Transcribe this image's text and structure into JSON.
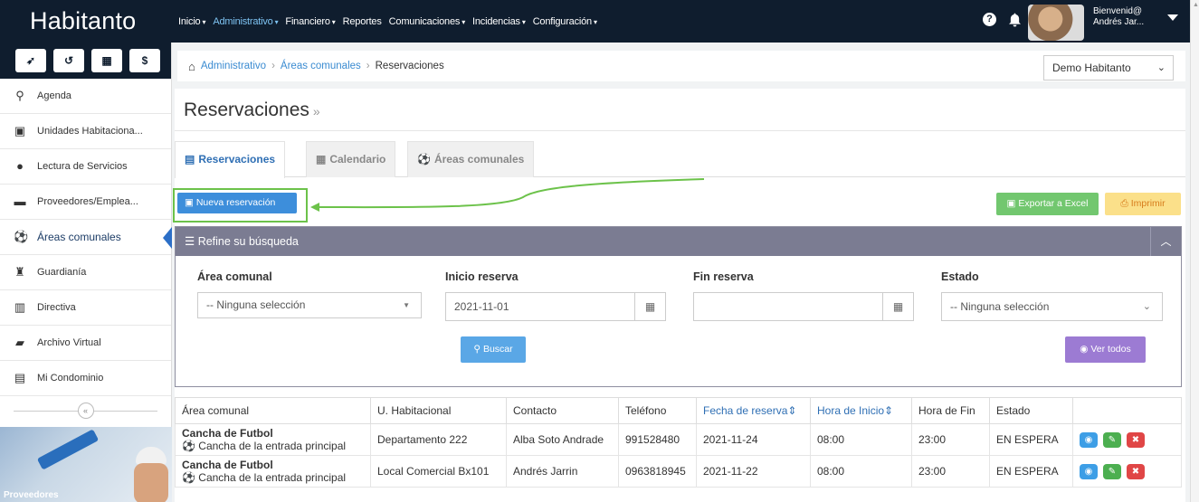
{
  "app": {
    "brand": "Habitanto",
    "menu": [
      {
        "label": "Inicio",
        "active": false
      },
      {
        "label": "Administrativo",
        "active": true
      },
      {
        "label": "Financiero",
        "active": false
      },
      {
        "label": "Reportes",
        "active": false,
        "no_caret": true
      },
      {
        "label": "Comunicaciones",
        "active": false
      },
      {
        "label": "Incidencias",
        "active": false
      },
      {
        "label": "Configuración",
        "active": false
      }
    ],
    "user": {
      "greeting": "Bienvenid@",
      "name": "Andrés Jar..."
    }
  },
  "sidebar": {
    "quick_icons": [
      "paper-plane-icon",
      "history-icon",
      "calculator-icon",
      "dollar-icon"
    ],
    "items": [
      {
        "label": "Agenda",
        "icon": "person-icon",
        "glyph": "🕴"
      },
      {
        "label": "Unidades Habitaciona...",
        "icon": "building-h-icon",
        "glyph": "🅷"
      },
      {
        "label": "Lectura de Servicios",
        "icon": "drop-icon",
        "glyph": "💧"
      },
      {
        "label": "Proveedores/Emplea...",
        "icon": "truck-icon",
        "glyph": "🚚"
      },
      {
        "label": "Áreas comunales",
        "icon": "soccer-ball-icon",
        "glyph": "⚽",
        "active": true
      },
      {
        "label": "Guardianía",
        "icon": "guard-icon",
        "glyph": "🛡"
      },
      {
        "label": "Directiva",
        "icon": "columns-icon",
        "glyph": "▥"
      },
      {
        "label": "Archivo Virtual",
        "icon": "folder-icon",
        "glyph": "📁"
      },
      {
        "label": "Mi Condominio",
        "icon": "apartment-icon",
        "glyph": "🏢"
      }
    ],
    "promo_text": "Proveedores"
  },
  "breadcrumb": {
    "items": [
      "Administrativo",
      "Áreas comunales",
      "Reservaciones"
    ]
  },
  "org_select": {
    "value": "Demo Habitanto"
  },
  "page": {
    "title": "Reservaciones",
    "title_suffix": "»"
  },
  "tabs": [
    {
      "label": "Reservaciones",
      "active": true
    },
    {
      "label": "Calendario",
      "active": false
    },
    {
      "label": "Áreas comunales",
      "active": false
    }
  ],
  "toolbar": {
    "new_label": "Nueva reservación",
    "excel_label": "Exportar a Excel",
    "print_label": "Imprimir"
  },
  "filter": {
    "title": "Refine su búsqueda",
    "area_label": "Área comunal",
    "area_value": "-- Ninguna selección",
    "start_label": "Inicio reserva",
    "start_value": "2021-11-01",
    "end_label": "Fin reserva",
    "end_value": "",
    "status_label": "Estado",
    "status_value": "-- Ninguna selección",
    "search_label": "Buscar",
    "all_label": "Ver todos"
  },
  "table": {
    "columns": [
      "Área comunal",
      "U. Habitacional",
      "Contacto",
      "Teléfono",
      "Fecha de reserva",
      "Hora de Inicio",
      "Hora de Fin",
      "Estado",
      ""
    ],
    "rows": [
      {
        "area": "Cancha de Futbol",
        "area_sub": "Cancha de la entrada principal",
        "unit": "Departamento 222",
        "contact": "Alba Soto Andrade",
        "phone": "991528480",
        "date": "2021-11-24",
        "start": "08:00",
        "end": "23:00",
        "status": "EN ESPERA"
      },
      {
        "area": "Cancha de Futbol",
        "area_sub": "Cancha de la entrada principal",
        "unit": "Local Comercial Bx101",
        "contact": "Andrés Jarrin",
        "phone": "0963818945",
        "date": "2021-11-22",
        "start": "08:00",
        "end": "23:00",
        "status": "EN ESPERA"
      }
    ]
  },
  "colors": {
    "topbar": "#0f1d2e",
    "accent": "#3d8edb",
    "filter_header": "#7b7c92",
    "highlight": "#6cc24a"
  }
}
